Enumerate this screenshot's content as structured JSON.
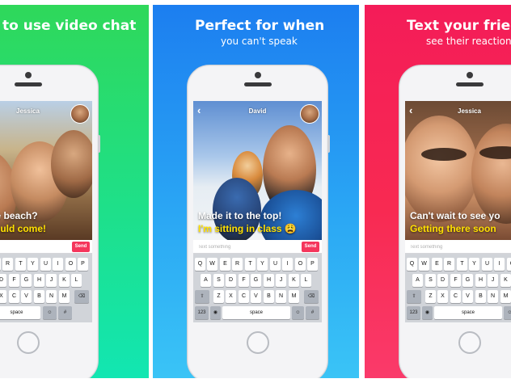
{
  "panels": [
    {
      "headline": "to use video chat",
      "subline": "",
      "contact_name": "Jessica",
      "message_line1": "w's the beach?",
      "message_line2": "ou should come!",
      "input_placeholder": "ething",
      "send_label": "Send",
      "keyboard": {
        "row1": [
          "Q",
          "W",
          "E",
          "R",
          "T",
          "Y",
          "U",
          "I",
          "O",
          "P"
        ],
        "row2": [
          "A",
          "S",
          "D",
          "F",
          "G",
          "H",
          "J",
          "K",
          "L"
        ],
        "row3": [
          "Z",
          "X",
          "C",
          "V",
          "B",
          "N",
          "M"
        ],
        "space_label": "space",
        "return_label": "#"
      }
    },
    {
      "headline": "Perfect for when",
      "subline": "you can't speak",
      "contact_name": "David",
      "message_line1": "Made it to the top!",
      "message_line2": "I'm sitting in class 😩",
      "input_placeholder": "Text something",
      "send_label": "Send",
      "keyboard": {
        "row1": [
          "Q",
          "W",
          "E",
          "R",
          "T",
          "Y",
          "U",
          "I",
          "O",
          "P"
        ],
        "row2": [
          "A",
          "S",
          "D",
          "F",
          "G",
          "H",
          "J",
          "K",
          "L"
        ],
        "row3": [
          "Z",
          "X",
          "C",
          "V",
          "B",
          "N",
          "M"
        ],
        "numbers_label": "123",
        "space_label": "space",
        "return_label": "#"
      }
    },
    {
      "headline": "Text your frien",
      "subline": "see their reactions",
      "contact_name": "Jessica",
      "message_line1": "Can't wait to see yo",
      "message_line2": "Getting there soon",
      "input_placeholder": "Text something",
      "send_label": "",
      "keyboard": {
        "row1": [
          "Q",
          "W",
          "E",
          "R",
          "T",
          "Y",
          "U",
          "I",
          "O"
        ],
        "row2": [
          "A",
          "S",
          "D",
          "F",
          "G",
          "H",
          "J",
          "K"
        ],
        "row3": [
          "Z",
          "X",
          "C",
          "V",
          "B",
          "N",
          "M"
        ],
        "numbers_label": "123",
        "space_label": "space",
        "return_label": ""
      }
    }
  ],
  "icons": {
    "shift": "shift-icon",
    "backspace": "backspace-icon",
    "globe": "globe-icon",
    "mic": "microphone-icon",
    "emoji": "emoji-icon",
    "back": "chevron-left-icon"
  },
  "colors": {
    "panel_green": "#1ee08a",
    "panel_blue": "#2aa6f4",
    "panel_red": "#f82a52",
    "send_button": "#f5365c",
    "message_yellow": "#ffe000"
  }
}
